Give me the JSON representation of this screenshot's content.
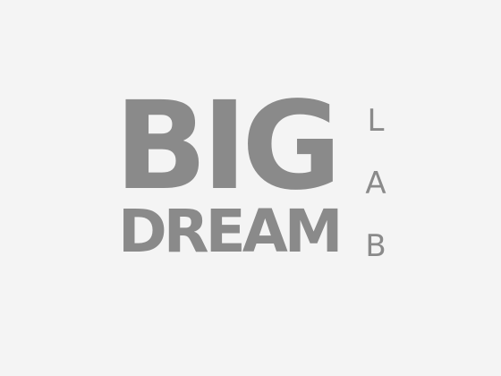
{
  "logo": {
    "big": "BIG",
    "dream": "DREAM",
    "lab_letters": [
      "L",
      "A",
      "B"
    ]
  },
  "colors": {
    "background": "#f4f4f4",
    "text": "#8a8a8a"
  }
}
